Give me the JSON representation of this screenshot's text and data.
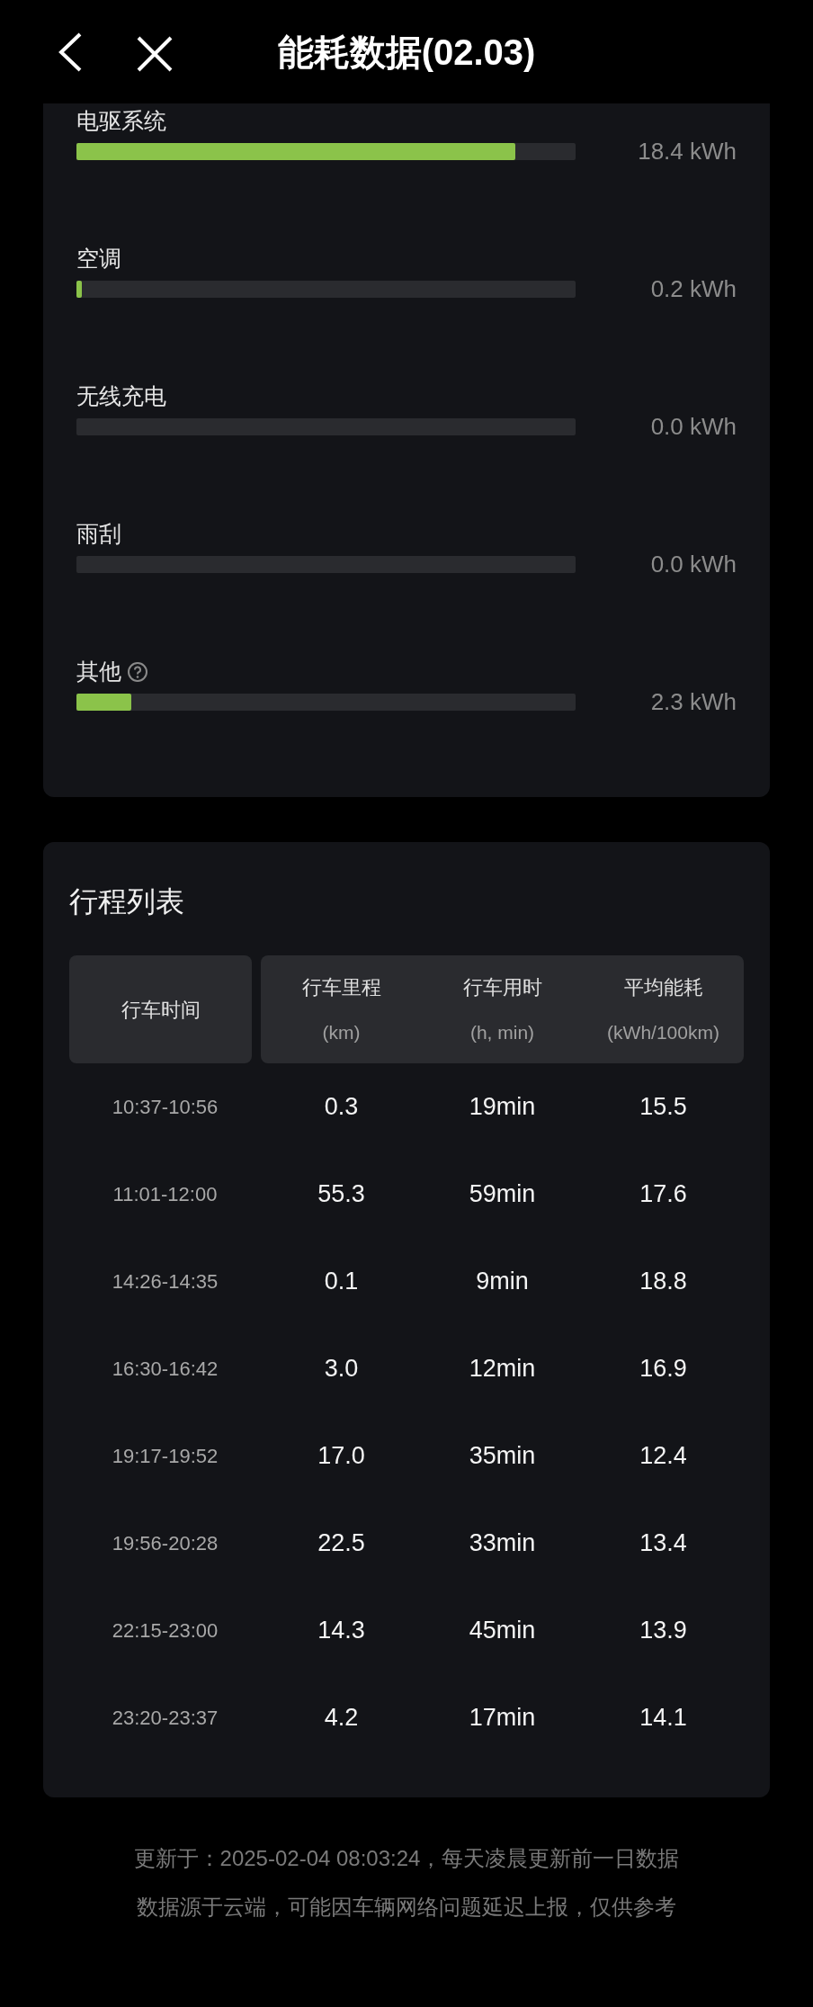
{
  "header": {
    "title": "能耗数据(02.03)"
  },
  "consumption": [
    {
      "label": "电驱系统",
      "level": 0.88,
      "reading": "18.4 kWh",
      "help": false
    },
    {
      "label": "空调",
      "level": 0.01,
      "reading": "0.2 kWh",
      "help": false
    },
    {
      "label": "无线充电",
      "level": 0,
      "reading": "0.0 kWh",
      "help": false
    },
    {
      "label": "雨刮",
      "level": 0,
      "reading": "0.0 kWh",
      "help": false
    },
    {
      "label": "其他",
      "level": 0.11,
      "reading": "2.3 kWh",
      "help": true
    }
  ],
  "trips": {
    "title": "行程列表",
    "columns": [
      {
        "label": "行车时间"
      },
      {
        "label": "行车里程",
        "unit": "(km)"
      },
      {
        "label": "行车用时",
        "unit": "(h, min)"
      },
      {
        "label": "平均能耗",
        "unit": "(kWh/100km)"
      }
    ],
    "rows": [
      [
        "10:37-10:56",
        "0.3",
        "19min",
        "15.5"
      ],
      [
        "11:01-12:00",
        "55.3",
        "59min",
        "17.6"
      ],
      [
        "14:26-14:35",
        "0.1",
        "9min",
        "18.8"
      ],
      [
        "16:30-16:42",
        "3.0",
        "12min",
        "16.9"
      ],
      [
        "19:17-19:52",
        "17.0",
        "35min",
        "12.4"
      ],
      [
        "19:56-20:28",
        "22.5",
        "33min",
        "13.4"
      ],
      [
        "22:15-23:00",
        "14.3",
        "45min",
        "13.9"
      ],
      [
        "23:20-23:37",
        "4.2",
        "17min",
        "14.1"
      ]
    ]
  },
  "footer": [
    "更新于：2025-02-04 08:03:24，每天凌晨更新前一日数据",
    "数据源于云端，可能因车辆网络问题延迟上报，仅供参考"
  ]
}
